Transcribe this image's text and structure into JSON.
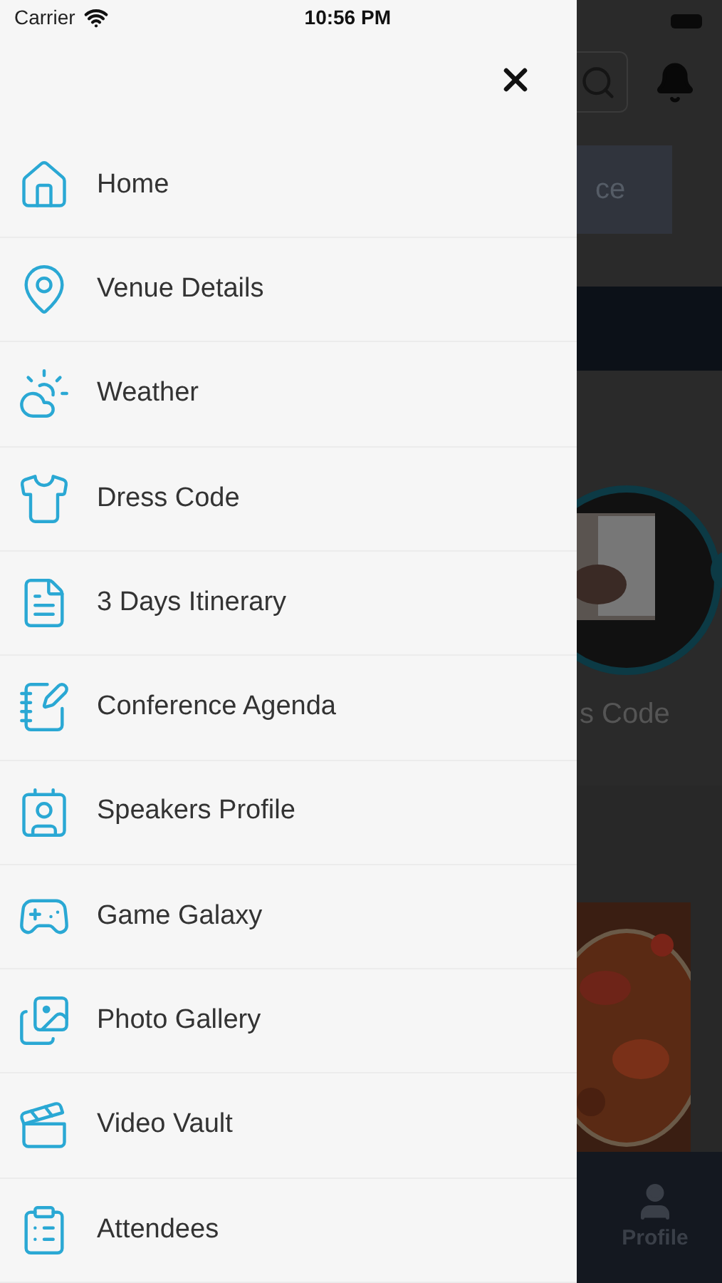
{
  "status_bar": {
    "carrier": "Carrier",
    "time": "10:56 PM"
  },
  "menu": {
    "items": [
      {
        "label": "Home"
      },
      {
        "label": "Venue Details"
      },
      {
        "label": "Weather"
      },
      {
        "label": "Dress Code"
      },
      {
        "label": "3 Days Itinerary"
      },
      {
        "label": "Conference Agenda"
      },
      {
        "label": "Speakers Profile"
      },
      {
        "label": "Game Galaxy"
      },
      {
        "label": "Photo Gallery"
      },
      {
        "label": "Video Vault"
      },
      {
        "label": "Attendees"
      }
    ]
  },
  "background": {
    "button_text": "ce",
    "card_label": "s Code",
    "tab_label": "Profile"
  }
}
